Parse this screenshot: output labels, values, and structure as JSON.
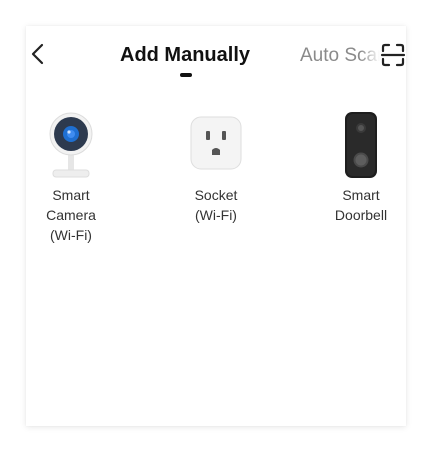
{
  "header": {
    "active_tab": "Add Manually",
    "inactive_tab": "Auto Scan"
  },
  "devices": [
    {
      "lines": [
        "Smart",
        "Camera",
        "(Wi-Fi)"
      ],
      "icon": "smart-camera-icon"
    },
    {
      "lines": [
        "Socket",
        "(Wi-Fi)"
      ],
      "icon": "socket-icon"
    },
    {
      "lines": [
        "Smart",
        "Doorbell"
      ],
      "icon": "doorbell-icon"
    }
  ],
  "colors": {
    "text_primary": "#111111",
    "text_secondary": "#8a8a8a",
    "label": "#333333",
    "camera_lens": "#1f6fd1"
  }
}
